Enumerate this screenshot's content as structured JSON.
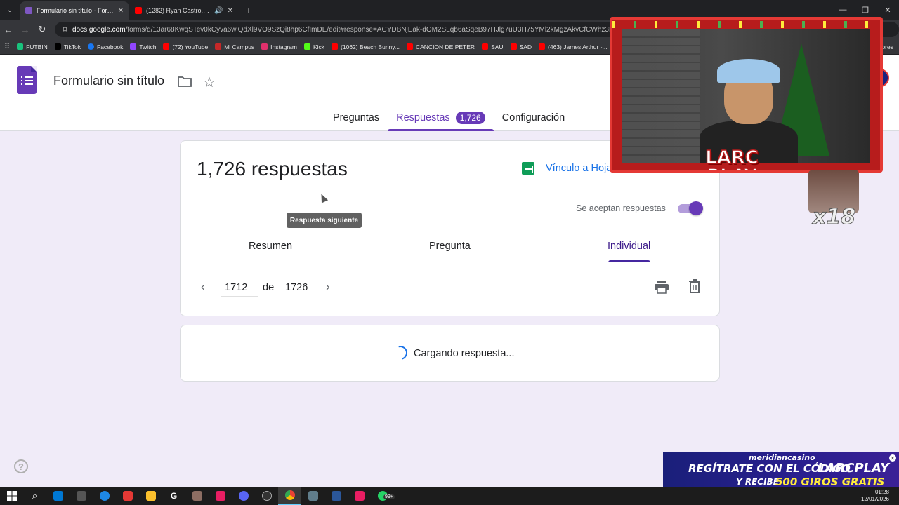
{
  "browser": {
    "tabs": [
      {
        "title": "Formulario sin título - Formular",
        "active": true,
        "favicon_color": "#7e57c2"
      },
      {
        "title": "(1282) Ryan Castro, Kapo, G",
        "active": false,
        "favicon_color": "#ff0000"
      }
    ],
    "url_host": "docs.google.com",
    "url_path": "/forms/d/13ar68KwqSTev0kCyva6wiQdXl9VO9SzQi8hp6CfImDE/edit#response=ACYDBNjEak-dOM2SLqb6aSqeB97HJlg7uU3H75YMl2kMgzAkvCfCWhz3K9nqOApbCNNu",
    "bookmarks": [
      {
        "label": "FUTBIN",
        "color": "#19c37d"
      },
      {
        "label": "TikTok",
        "color": "#000000"
      },
      {
        "label": "Facebook",
        "color": "#1877f2"
      },
      {
        "label": "Twitch",
        "color": "#9146ff"
      },
      {
        "label": "(72) YouTube",
        "color": "#ff0000"
      },
      {
        "label": "Mi Campus",
        "color": "#c62828"
      },
      {
        "label": "Instagram",
        "color": "#e1306c"
      },
      {
        "label": "Kick",
        "color": "#53fc18"
      },
      {
        "label": "(1062) Beach Bunny...",
        "color": "#ff0000"
      },
      {
        "label": "CANCION DE PETER",
        "color": "#ff0000"
      },
      {
        "label": "SAU",
        "color": "#ff0000"
      },
      {
        "label": "SAD",
        "color": "#ff0000"
      },
      {
        "label": "(463) James Arthur -...",
        "color": "#ff0000"
      },
      {
        "label": "ores",
        "color": "#35363a"
      }
    ]
  },
  "header": {
    "title": "Formulario sin título",
    "avatar_letter": "F"
  },
  "tabs": [
    {
      "label": "Preguntas",
      "active": false
    },
    {
      "label": "Respuestas",
      "active": true,
      "badge": "1,726"
    },
    {
      "label": "Configuración",
      "active": false
    }
  ],
  "responses": {
    "count_label": "1,726 respuestas",
    "sheets_link": "Vínculo a Hojas de cálculo",
    "accepting_label": "Se aceptan respuestas",
    "accepting": true,
    "subtabs": [
      "Resumen",
      "Pregunta",
      "Individual"
    ],
    "active_subtab": "Individual",
    "current": "1712",
    "of_label": "de",
    "total": "1726",
    "tooltip": "Respuesta siguiente",
    "loading_text": "Cargando respuesta..."
  },
  "overlay": {
    "logo_line1": "LARC",
    "logo_line2": "PLAY",
    "meme_text": "x18"
  },
  "ad": {
    "brand": "meridiancasino",
    "line1": "REGÍTRATE CON EL CÓDIGO",
    "code": "LARCPLAY",
    "line2a": "Y RECIBE",
    "line2b": "500 GIROS GRATIS"
  },
  "taskbar": {
    "time": "01:28",
    "date": "12/01/2026",
    "badge": "99+"
  },
  "colors": {
    "accent": "#673ab7",
    "background": "#f0ebf8",
    "link": "#1a73e8"
  }
}
